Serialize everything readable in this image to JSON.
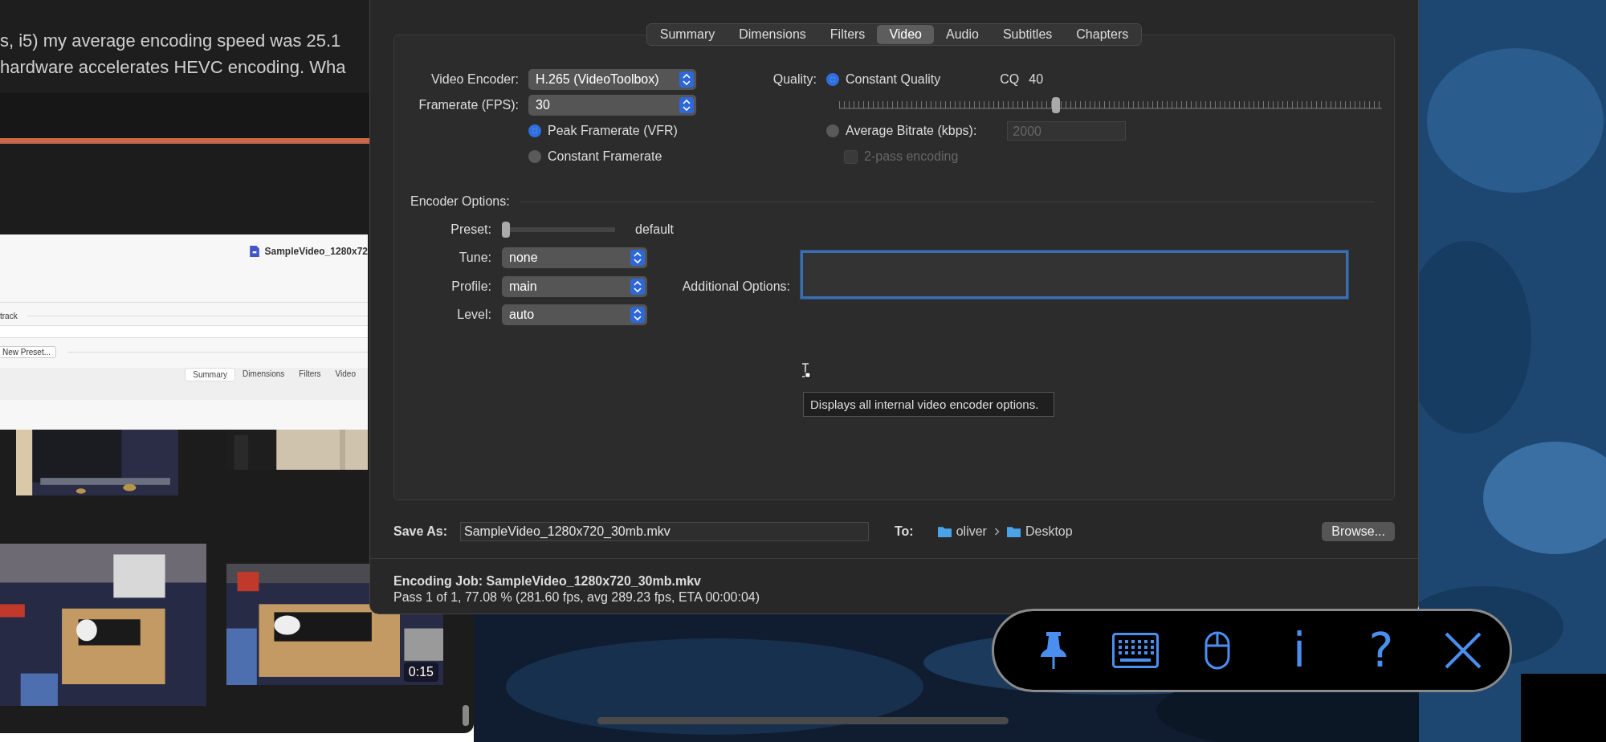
{
  "browser": {
    "text_lines": [
      "s, i5) my average encoding speed was 25.1",
      "hardware accelerates HEVC encoding. Wha"
    ],
    "screenshot": {
      "file_name": "SampleVideo_1280x72",
      "section": "track",
      "button": "New Preset...",
      "tabs": [
        {
          "label": "Summary",
          "selected": true
        },
        {
          "label": "Dimensions",
          "selected": false
        },
        {
          "label": "Filters",
          "selected": false
        },
        {
          "label": "Video",
          "selected": false
        }
      ]
    },
    "thumbnails": [
      {
        "kind": "picture"
      },
      {
        "kind": "picture"
      },
      {
        "kind": "picture"
      },
      {
        "kind": "picture",
        "duration": "0:15"
      }
    ]
  },
  "handbrake": {
    "tabs": [
      {
        "label": "Summary",
        "selected": false
      },
      {
        "label": "Dimensions",
        "selected": false
      },
      {
        "label": "Filters",
        "selected": false
      },
      {
        "label": "Video",
        "selected": true
      },
      {
        "label": "Audio",
        "selected": false
      },
      {
        "label": "Subtitles",
        "selected": false
      },
      {
        "label": "Chapters",
        "selected": false
      }
    ],
    "encoder": {
      "label": "Video Encoder:",
      "value": "H.265 (VideoToolbox)"
    },
    "framerate": {
      "label": "Framerate (FPS):",
      "value": "30"
    },
    "framerate_modes": [
      {
        "label": "Peak Framerate (VFR)",
        "selected": true
      },
      {
        "label": "Constant Framerate",
        "selected": false
      }
    ],
    "quality": {
      "label": "Quality:",
      "modes": [
        {
          "label": "Constant Quality",
          "selected": true
        },
        {
          "label": "Average Bitrate (kbps):",
          "selected": false
        }
      ],
      "cq_label": "CQ",
      "cq_value": "40",
      "level": 0.4,
      "bitrate": {
        "value": "2000",
        "disabled": true
      },
      "two_pass": {
        "label": "2-pass encoding",
        "checked": false,
        "disabled": true
      }
    },
    "encoder_options": {
      "title": "Encoder Options:",
      "preset": {
        "label": "Preset:",
        "level": 0,
        "reading": "default"
      },
      "selects": [
        {
          "label": "Tune:",
          "value": "none"
        },
        {
          "label": "Profile:",
          "value": "main"
        },
        {
          "label": "Level:",
          "value": "auto"
        }
      ],
      "additional": {
        "label": "Additional Options:",
        "focused": true
      }
    },
    "tooltip": "Displays all internal video encoder options.",
    "save_as": {
      "label": "Save As:",
      "value": "SampleVideo_1280x720_30mb.mkv"
    },
    "destination": {
      "label": "To:",
      "path": [
        "oliver",
        "Desktop"
      ]
    },
    "browse": "Browse...",
    "status": {
      "title": "Encoding Job: SampleVideo_1280x720_30mb.mkv",
      "progress": "Pass 1 of 1, 77.08 % (281.60 fps, avg 289.23 fps, ETA 00:00:04)"
    }
  },
  "toolbar": [
    {
      "kind": "pin"
    },
    {
      "kind": "keyboard"
    },
    {
      "kind": "mouse"
    },
    {
      "kind": "text",
      "label": "i"
    },
    {
      "kind": "text",
      "label": "?"
    },
    {
      "kind": "close"
    }
  ]
}
